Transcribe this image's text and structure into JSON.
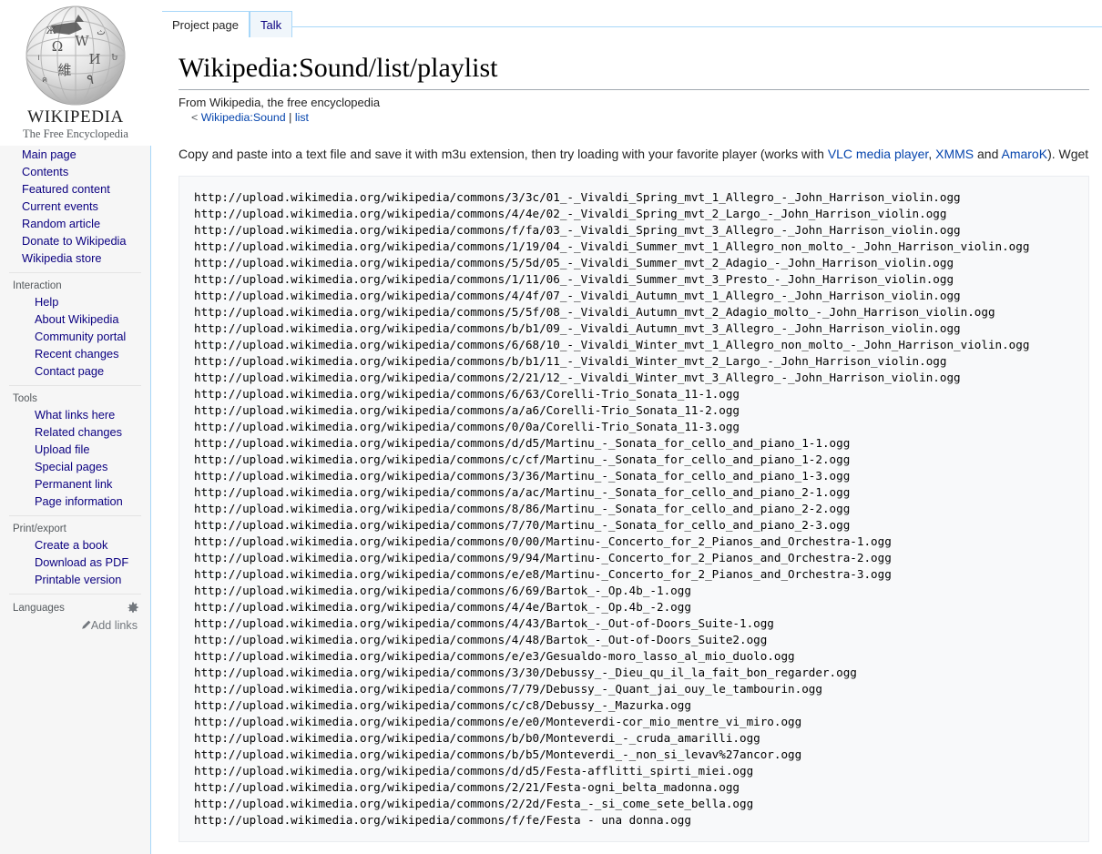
{
  "sidebar": {
    "logo": {
      "wordmark": "WIKIPEDIA",
      "tagline": "The Free Encyclopedia",
      "globe_icon": "wikipedia-globe-icon"
    },
    "navigation": {
      "heading": "",
      "items": [
        "Main page",
        "Contents",
        "Featured content",
        "Current events",
        "Random article",
        "Donate to Wikipedia",
        "Wikipedia store"
      ]
    },
    "interaction": {
      "heading": "Interaction",
      "items": [
        "Help",
        "About Wikipedia",
        "Community portal",
        "Recent changes",
        "Contact page"
      ]
    },
    "tools": {
      "heading": "Tools",
      "items": [
        "What links here",
        "Related changes",
        "Upload file",
        "Special pages",
        "Permanent link",
        "Page information"
      ]
    },
    "print_export": {
      "heading": "Print/export",
      "items": [
        "Create a book",
        "Download as PDF",
        "Printable version"
      ]
    },
    "languages": {
      "heading": "Languages",
      "gear_icon": "gear-icon",
      "pencil_icon": "pencil-icon",
      "add_links": "Add links"
    }
  },
  "tabs": [
    {
      "label": "Project page",
      "active": true
    },
    {
      "label": "Talk",
      "active": false
    }
  ],
  "page": {
    "title": "Wikipedia:Sound/list/playlist",
    "site_sub": "From Wikipedia, the free encyclopedia",
    "content_sub_prefix": "<",
    "content_sub_links": [
      "Wikipedia:Sound",
      "list"
    ],
    "content_sub_separator": "|"
  },
  "intro": {
    "text_1": "Copy and paste into a text file and save it with m3u extension, then try loading with your favorite player (works with ",
    "link_1": "VLC media player",
    "text_2": ", ",
    "link_2": "XMMS",
    "text_3": " and ",
    "link_3": "AmaroK",
    "text_4": "). Wget"
  },
  "playlist": {
    "lines": [
      "http://upload.wikimedia.org/wikipedia/commons/3/3c/01_-_Vivaldi_Spring_mvt_1_Allegro_-_John_Harrison_violin.ogg",
      "http://upload.wikimedia.org/wikipedia/commons/4/4e/02_-_Vivaldi_Spring_mvt_2_Largo_-_John_Harrison_violin.ogg",
      "http://upload.wikimedia.org/wikipedia/commons/f/fa/03_-_Vivaldi_Spring_mvt_3_Allegro_-_John_Harrison_violin.ogg",
      "http://upload.wikimedia.org/wikipedia/commons/1/19/04_-_Vivaldi_Summer_mvt_1_Allegro_non_molto_-_John_Harrison_violin.ogg",
      "http://upload.wikimedia.org/wikipedia/commons/5/5d/05_-_Vivaldi_Summer_mvt_2_Adagio_-_John_Harrison_violin.ogg",
      "http://upload.wikimedia.org/wikipedia/commons/1/11/06_-_Vivaldi_Summer_mvt_3_Presto_-_John_Harrison_violin.ogg",
      "http://upload.wikimedia.org/wikipedia/commons/4/4f/07_-_Vivaldi_Autumn_mvt_1_Allegro_-_John_Harrison_violin.ogg",
      "http://upload.wikimedia.org/wikipedia/commons/5/5f/08_-_Vivaldi_Autumn_mvt_2_Adagio_molto_-_John_Harrison_violin.ogg",
      "http://upload.wikimedia.org/wikipedia/commons/b/b1/09_-_Vivaldi_Autumn_mvt_3_Allegro_-_John_Harrison_violin.ogg",
      "http://upload.wikimedia.org/wikipedia/commons/6/68/10_-_Vivaldi_Winter_mvt_1_Allegro_non_molto_-_John_Harrison_violin.ogg",
      "http://upload.wikimedia.org/wikipedia/commons/b/b1/11_-_Vivaldi_Winter_mvt_2_Largo_-_John_Harrison_violin.ogg",
      "http://upload.wikimedia.org/wikipedia/commons/2/21/12_-_Vivaldi_Winter_mvt_3_Allegro_-_John_Harrison_violin.ogg",
      "http://upload.wikimedia.org/wikipedia/commons/6/63/Corelli-Trio_Sonata_11-1.ogg",
      "http://upload.wikimedia.org/wikipedia/commons/a/a6/Corelli-Trio_Sonata_11-2.ogg",
      "http://upload.wikimedia.org/wikipedia/commons/0/0a/Corelli-Trio_Sonata_11-3.ogg",
      "http://upload.wikimedia.org/wikipedia/commons/d/d5/Martinu_-_Sonata_for_cello_and_piano_1-1.ogg",
      "http://upload.wikimedia.org/wikipedia/commons/c/cf/Martinu_-_Sonata_for_cello_and_piano_1-2.ogg",
      "http://upload.wikimedia.org/wikipedia/commons/3/36/Martinu_-_Sonata_for_cello_and_piano_1-3.ogg",
      "http://upload.wikimedia.org/wikipedia/commons/a/ac/Martinu_-_Sonata_for_cello_and_piano_2-1.ogg",
      "http://upload.wikimedia.org/wikipedia/commons/8/86/Martinu_-_Sonata_for_cello_and_piano_2-2.ogg",
      "http://upload.wikimedia.org/wikipedia/commons/7/70/Martinu_-_Sonata_for_cello_and_piano_2-3.ogg",
      "http://upload.wikimedia.org/wikipedia/commons/0/00/Martinu-_Concerto_for_2_Pianos_and_Orchestra-1.ogg",
      "http://upload.wikimedia.org/wikipedia/commons/9/94/Martinu-_Concerto_for_2_Pianos_and_Orchestra-2.ogg",
      "http://upload.wikimedia.org/wikipedia/commons/e/e8/Martinu-_Concerto_for_2_Pianos_and_Orchestra-3.ogg",
      "http://upload.wikimedia.org/wikipedia/commons/6/69/Bartok_-_Op.4b_-1.ogg",
      "http://upload.wikimedia.org/wikipedia/commons/4/4e/Bartok_-_Op.4b_-2.ogg",
      "http://upload.wikimedia.org/wikipedia/commons/4/43/Bartok_-_Out-of-Doors_Suite-1.ogg",
      "http://upload.wikimedia.org/wikipedia/commons/4/48/Bartok_-_Out-of-Doors_Suite2.ogg",
      "http://upload.wikimedia.org/wikipedia/commons/e/e3/Gesualdo-moro_lasso_al_mio_duolo.ogg",
      "http://upload.wikimedia.org/wikipedia/commons/3/30/Debussy_-_Dieu_qu_il_la_fait_bon_regarder.ogg",
      "http://upload.wikimedia.org/wikipedia/commons/7/79/Debussy_-_Quant_jai_ouy_le_tambourin.ogg",
      "http://upload.wikimedia.org/wikipedia/commons/c/c8/Debussy_-_Mazurka.ogg",
      "http://upload.wikimedia.org/wikipedia/commons/e/e0/Monteverdi-cor_mio_mentre_vi_miro.ogg",
      "http://upload.wikimedia.org/wikipedia/commons/b/b0/Monteverdi_-_cruda_amarilli.ogg",
      "http://upload.wikimedia.org/wikipedia/commons/b/b5/Monteverdi_-_non_si_levav%27ancor.ogg",
      "http://upload.wikimedia.org/wikipedia/commons/d/d5/Festa-afflitti_spirti_miei.ogg",
      "http://upload.wikimedia.org/wikipedia/commons/2/21/Festa-ogni_belta_madonna.ogg",
      "http://upload.wikimedia.org/wikipedia/commons/2/2d/Festa_-_si_come_sete_bella.ogg",
      "http://upload.wikimedia.org/wikipedia/commons/f/fe/Festa - una donna.ogg"
    ]
  }
}
